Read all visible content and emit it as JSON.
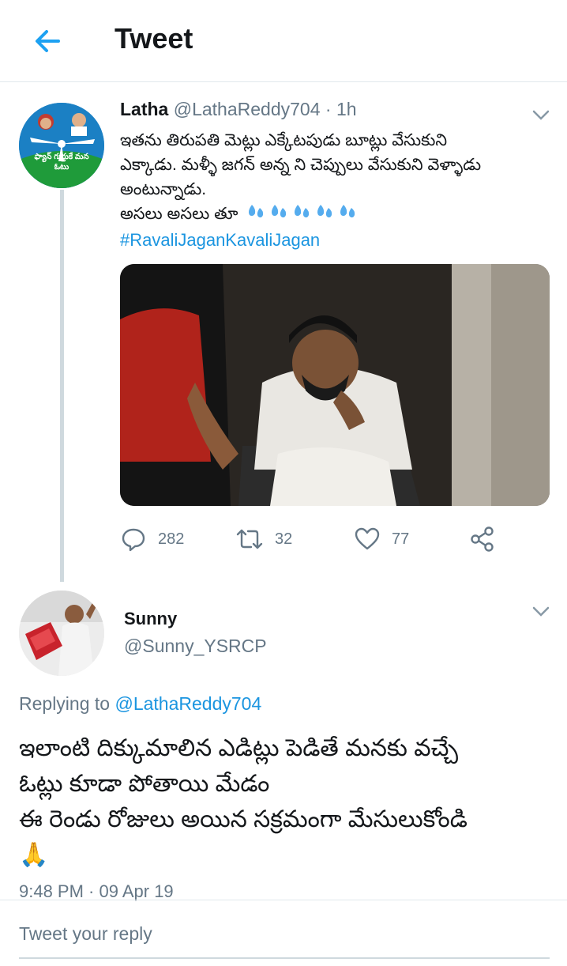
{
  "header": {
    "title": "Tweet",
    "back_icon": "arrow-left-icon",
    "accent": "#1da1f2"
  },
  "tweet1": {
    "name": "Latha",
    "handle": "@LathaReddy704",
    "meta_separator": " · ",
    "time": "1h",
    "lines": [
      "ఇతను తిరుపతి మెట్లు ఎక్కేటపుడు బూట్లు వేసుకుని",
      "ఎక్కాడు. మళ్ళీ జగన్ అన్న ని చెప్పులు వేసుకుని వెళ్ళాడు",
      "అంటున్నాడు.",
      "అసలు అసలు తూ"
    ],
    "hashtag": "#RavaliJaganKavaliJagan",
    "avatar_text": "ఫ్యాన్ గుర్తుకే మన ఓటు",
    "stats": {
      "replies": "282",
      "retweets": "32",
      "likes": "77"
    }
  },
  "tweet2": {
    "name": "Sunny",
    "handle": "@Sunny_YSRCP",
    "replying_prefix": "Replying to ",
    "replying_to": "@LathaReddy704",
    "lines": [
      "ఇలాంటి దిక్కుమాలిన ఎడిట్లు పెడితే మనకు వచ్చే",
      "ఓట్లు కూడా పోతాయి మేడం",
      "ఈ రెండు రోజులు అయిన సక్రమంగా మేసులుకోండి",
      "🙏"
    ],
    "timestamp": "9:48 PM · 09 Apr 19"
  },
  "reply": {
    "placeholder": "Tweet your reply"
  },
  "colors": {
    "link": "#1b95e0",
    "secondary_text": "#657786",
    "divider": "#e1e8ed"
  }
}
